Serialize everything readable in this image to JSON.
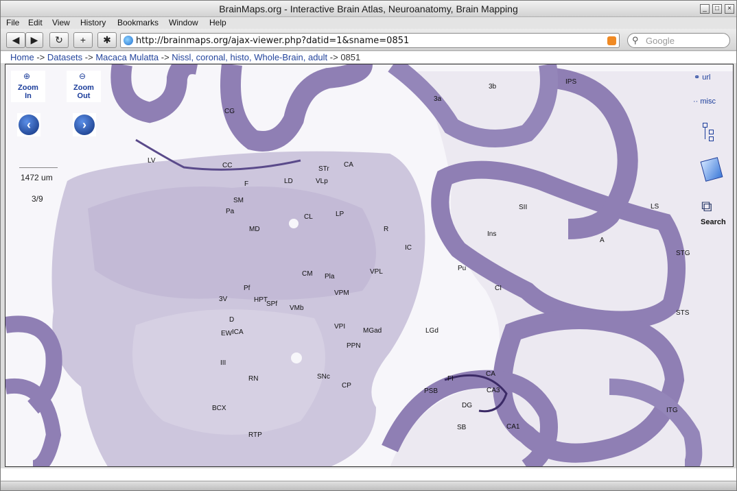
{
  "window": {
    "title": "BrainMaps.org - Interactive Brain Atlas, Neuroanatomy, Brain Mapping"
  },
  "menu": [
    "File",
    "Edit",
    "View",
    "History",
    "Bookmarks",
    "Window",
    "Help"
  ],
  "toolbar": {
    "back": "◀",
    "forward": "▶",
    "reload": "↻",
    "new_tab": "+"
  },
  "address": {
    "url": "http://brainmaps.org/ajax-viewer.php?datid=1&sname=0851"
  },
  "search": {
    "placeholder": "Google"
  },
  "breadcrumb": {
    "links": [
      "Home",
      "Datasets",
      "Macaca Mulatta",
      "Nissl, coronal, histo, Whole-Brain, adult"
    ],
    "separator": "->",
    "current": "0851"
  },
  "viewer": {
    "zoom_in": [
      "Zoom",
      "In"
    ],
    "zoom_out": [
      "Zoom",
      "Out"
    ],
    "scale": "1472 um",
    "page": "3/9",
    "tools": {
      "url": "url",
      "misc": "misc",
      "search": "Search"
    },
    "labels": [
      "CG",
      "LV",
      "CC",
      "F",
      "SM",
      "Pa",
      "LD",
      "STr",
      "VLp",
      "CA",
      "CL",
      "LP",
      "MD",
      "R",
      "IC",
      "Pu",
      "CM",
      "Pla",
      "VPL",
      "Pf",
      "3V",
      "HPT",
      "SPf",
      "VMb",
      "VPM",
      "D",
      "EW",
      "ICA",
      "VPI",
      "MGad",
      "PPN",
      "III",
      "RN",
      "SNc",
      "CP",
      "BCX",
      "RTP",
      "LGd",
      "FI",
      "CA",
      "CA3",
      "PSB",
      "DG",
      "SB",
      "CA1",
      "3a",
      "3b",
      "IPS",
      "SII",
      "Ins",
      "LS",
      "A",
      "STG",
      "CI",
      "STS",
      "ITG"
    ]
  },
  "colors": {
    "link": "#23449c",
    "tissue": "#c9c3da",
    "cortex": "#8f7fb4",
    "white_matter": "#ece9f1"
  }
}
